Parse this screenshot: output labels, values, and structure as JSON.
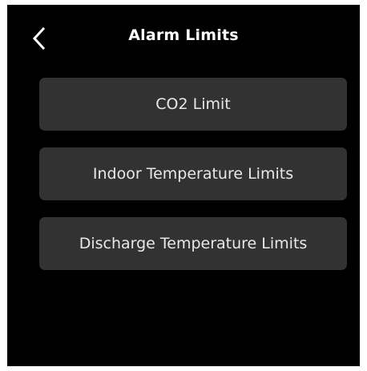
{
  "header": {
    "title": "Alarm Limits",
    "back_icon": "chevron-left-icon"
  },
  "menu": {
    "items": [
      {
        "label": "CO2 Limit"
      },
      {
        "label": "Indoor Temperature Limits"
      },
      {
        "label": "Discharge Temperature Limits"
      }
    ]
  },
  "colors": {
    "background": "#000000",
    "button": "#323232",
    "text": "#ffffff"
  }
}
